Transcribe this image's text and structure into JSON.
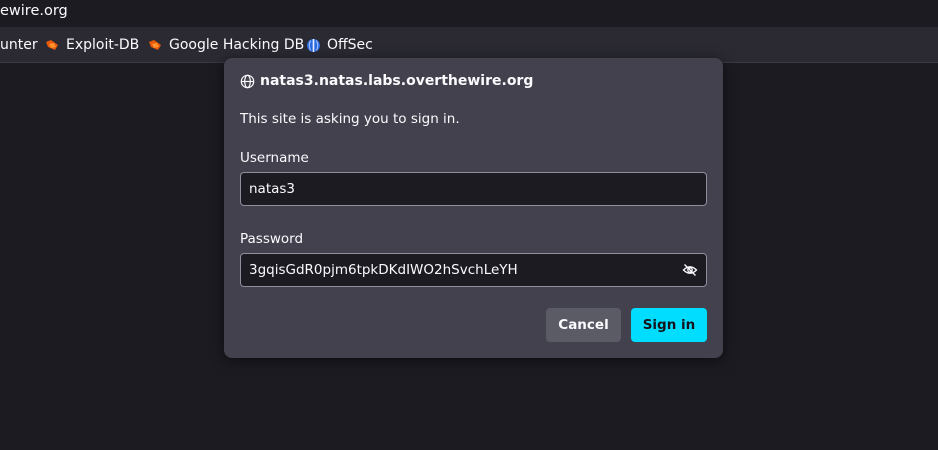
{
  "browser": {
    "url_fragment": "ewire.org",
    "bookmarks": [
      {
        "label": "unter",
        "icon": "bookmark-favicon"
      },
      {
        "label": "Exploit-DB",
        "icon": "exploit-db-icon"
      },
      {
        "label": "Google Hacking DB",
        "icon": "exploit-db-icon"
      },
      {
        "label": "OffSec",
        "icon": "offsec-icon"
      }
    ]
  },
  "dialog": {
    "host": "natas3.natas.labs.overthewire.org",
    "host_icon": "globe-icon",
    "message": "This site is asking you to sign in.",
    "username_label": "Username",
    "username_value": "natas3",
    "password_label": "Password",
    "password_value": "3gqisGdR0pjm6tpkDKdIWO2hSvchLeYH",
    "reveal_icon": "eye-slash-icon",
    "cancel_label": "Cancel",
    "signin_label": "Sign in"
  },
  "colors": {
    "accent": "#00ddff",
    "dialog_bg": "#42414d",
    "page_bg": "#1c1b22",
    "toolbar_bg": "#2b2a33"
  }
}
